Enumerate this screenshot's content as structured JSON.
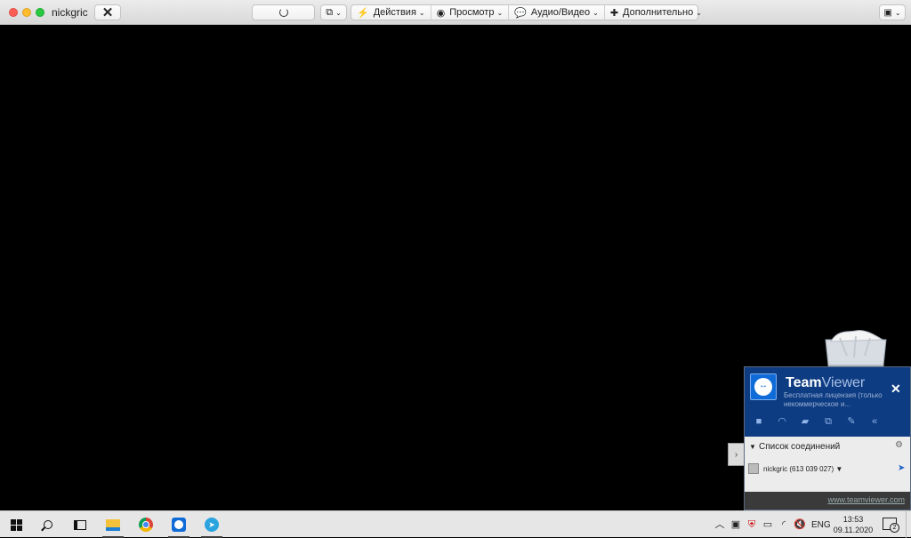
{
  "window": {
    "title": "nickgric",
    "menu": [
      {
        "label": "Действия",
        "icon": "lightning-icon"
      },
      {
        "label": "Просмотр",
        "icon": "eye-icon"
      },
      {
        "label": "Аудио/Видео",
        "icon": "chat-bubbles-icon"
      },
      {
        "label": "Дополнительно",
        "icon": "puzzle-icon"
      }
    ],
    "chevron": "⌄"
  },
  "teamviewer": {
    "brand_bold": "Team",
    "brand_light": "Viewer",
    "license": "Бесплатная лицензия (только некоммерческое и...",
    "connection_list_label": "Список соединений",
    "connection": "nickgric (613 039 027)",
    "link": "www.teamviewer.com",
    "colors": {
      "header": "#0e3c82",
      "accent": "#0e6bd8"
    }
  },
  "taskbar": {
    "language": "ENG",
    "time": "13:53",
    "date": "09.11.2020",
    "notification_count": "2"
  }
}
